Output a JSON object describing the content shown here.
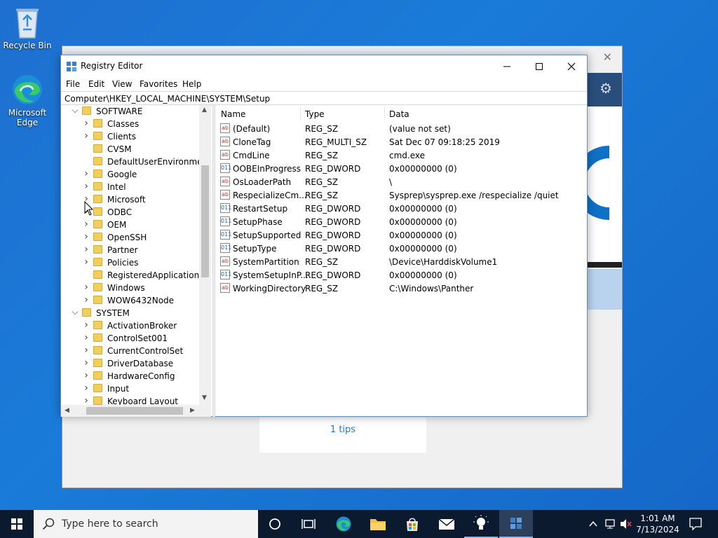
{
  "desktop": {
    "icons": [
      {
        "label": "Recycle Bin"
      },
      {
        "label": "Microsoft\nEdge"
      }
    ]
  },
  "background_window": {
    "tips_text": "1 tips"
  },
  "regedit": {
    "title": "Registry Editor",
    "menu": [
      "File",
      "Edit",
      "View",
      "Favorites",
      "Help"
    ],
    "address": "Computer\\HKEY_LOCAL_MACHINE\\SYSTEM\\Setup",
    "tree": [
      {
        "label": "SOFTWARE",
        "expanded": true,
        "level": 0
      },
      {
        "label": "Classes",
        "level": 1,
        "has_children": true
      },
      {
        "label": "Clients",
        "level": 1,
        "has_children": true
      },
      {
        "label": "CVSM",
        "level": 1,
        "has_children": false
      },
      {
        "label": "DefaultUserEnvironment",
        "level": 1,
        "has_children": false
      },
      {
        "label": "Google",
        "level": 1,
        "has_children": true
      },
      {
        "label": "Intel",
        "level": 1,
        "has_children": true
      },
      {
        "label": "Microsoft",
        "level": 1,
        "has_children": true
      },
      {
        "label": "ODBC",
        "level": 1,
        "has_children": true
      },
      {
        "label": "OEM",
        "level": 1,
        "has_children": true
      },
      {
        "label": "OpenSSH",
        "level": 1,
        "has_children": true
      },
      {
        "label": "Partner",
        "level": 1,
        "has_children": true
      },
      {
        "label": "Policies",
        "level": 1,
        "has_children": true
      },
      {
        "label": "RegisteredApplications",
        "level": 1,
        "has_children": false
      },
      {
        "label": "Windows",
        "level": 1,
        "has_children": true
      },
      {
        "label": "WOW6432Node",
        "level": 1,
        "has_children": true
      },
      {
        "label": "SYSTEM",
        "expanded": true,
        "level": 0
      },
      {
        "label": "ActivationBroker",
        "level": 1,
        "has_children": true
      },
      {
        "label": "ControlSet001",
        "level": 1,
        "has_children": true
      },
      {
        "label": "CurrentControlSet",
        "level": 1,
        "has_children": true
      },
      {
        "label": "DriverDatabase",
        "level": 1,
        "has_children": true
      },
      {
        "label": "HardwareConfig",
        "level": 1,
        "has_children": true
      },
      {
        "label": "Input",
        "level": 1,
        "has_children": true
      },
      {
        "label": "Keyboard Layout",
        "level": 1,
        "has_children": true
      }
    ],
    "columns": [
      "Name",
      "Type",
      "Data"
    ],
    "values": [
      {
        "name": "(Default)",
        "type": "REG_SZ",
        "data": "(value not set)",
        "icon": "ab"
      },
      {
        "name": "CloneTag",
        "type": "REG_MULTI_SZ",
        "data": "Sat Dec 07 09:18:25 2019",
        "icon": "ab"
      },
      {
        "name": "CmdLine",
        "type": "REG_SZ",
        "data": "cmd.exe",
        "icon": "ab"
      },
      {
        "name": "OOBEInProgress",
        "type": "REG_DWORD",
        "data": "0x00000000 (0)",
        "icon": "bin"
      },
      {
        "name": "OsLoaderPath",
        "type": "REG_SZ",
        "data": "\\",
        "icon": "ab"
      },
      {
        "name": "RespecializeCm...",
        "type": "REG_SZ",
        "data": "Sysprep\\sysprep.exe /respecialize /quiet",
        "icon": "ab"
      },
      {
        "name": "RestartSetup",
        "type": "REG_DWORD",
        "data": "0x00000000 (0)",
        "icon": "bin"
      },
      {
        "name": "SetupPhase",
        "type": "REG_DWORD",
        "data": "0x00000000 (0)",
        "icon": "bin"
      },
      {
        "name": "SetupSupported",
        "type": "REG_DWORD",
        "data": "0x00000000 (0)",
        "icon": "bin"
      },
      {
        "name": "SetupType",
        "type": "REG_DWORD",
        "data": "0x00000000 (0)",
        "icon": "bin"
      },
      {
        "name": "SystemPartition",
        "type": "REG_SZ",
        "data": "\\Device\\HarddiskVolume1",
        "icon": "ab"
      },
      {
        "name": "SystemSetupInP...",
        "type": "REG_DWORD",
        "data": "0x00000000 (0)",
        "icon": "bin"
      },
      {
        "name": "WorkingDirectory",
        "type": "REG_SZ",
        "data": "C:\\Windows\\Panther",
        "icon": "ab"
      }
    ]
  },
  "taskbar": {
    "search_placeholder": "Type here to search",
    "time": "1:01 AM",
    "date": "7/13/2024"
  },
  "colors": {
    "desktop_blue": "#1a7bd8",
    "taskbar": "#0b1a2f",
    "folder": "#f2cf5b"
  }
}
